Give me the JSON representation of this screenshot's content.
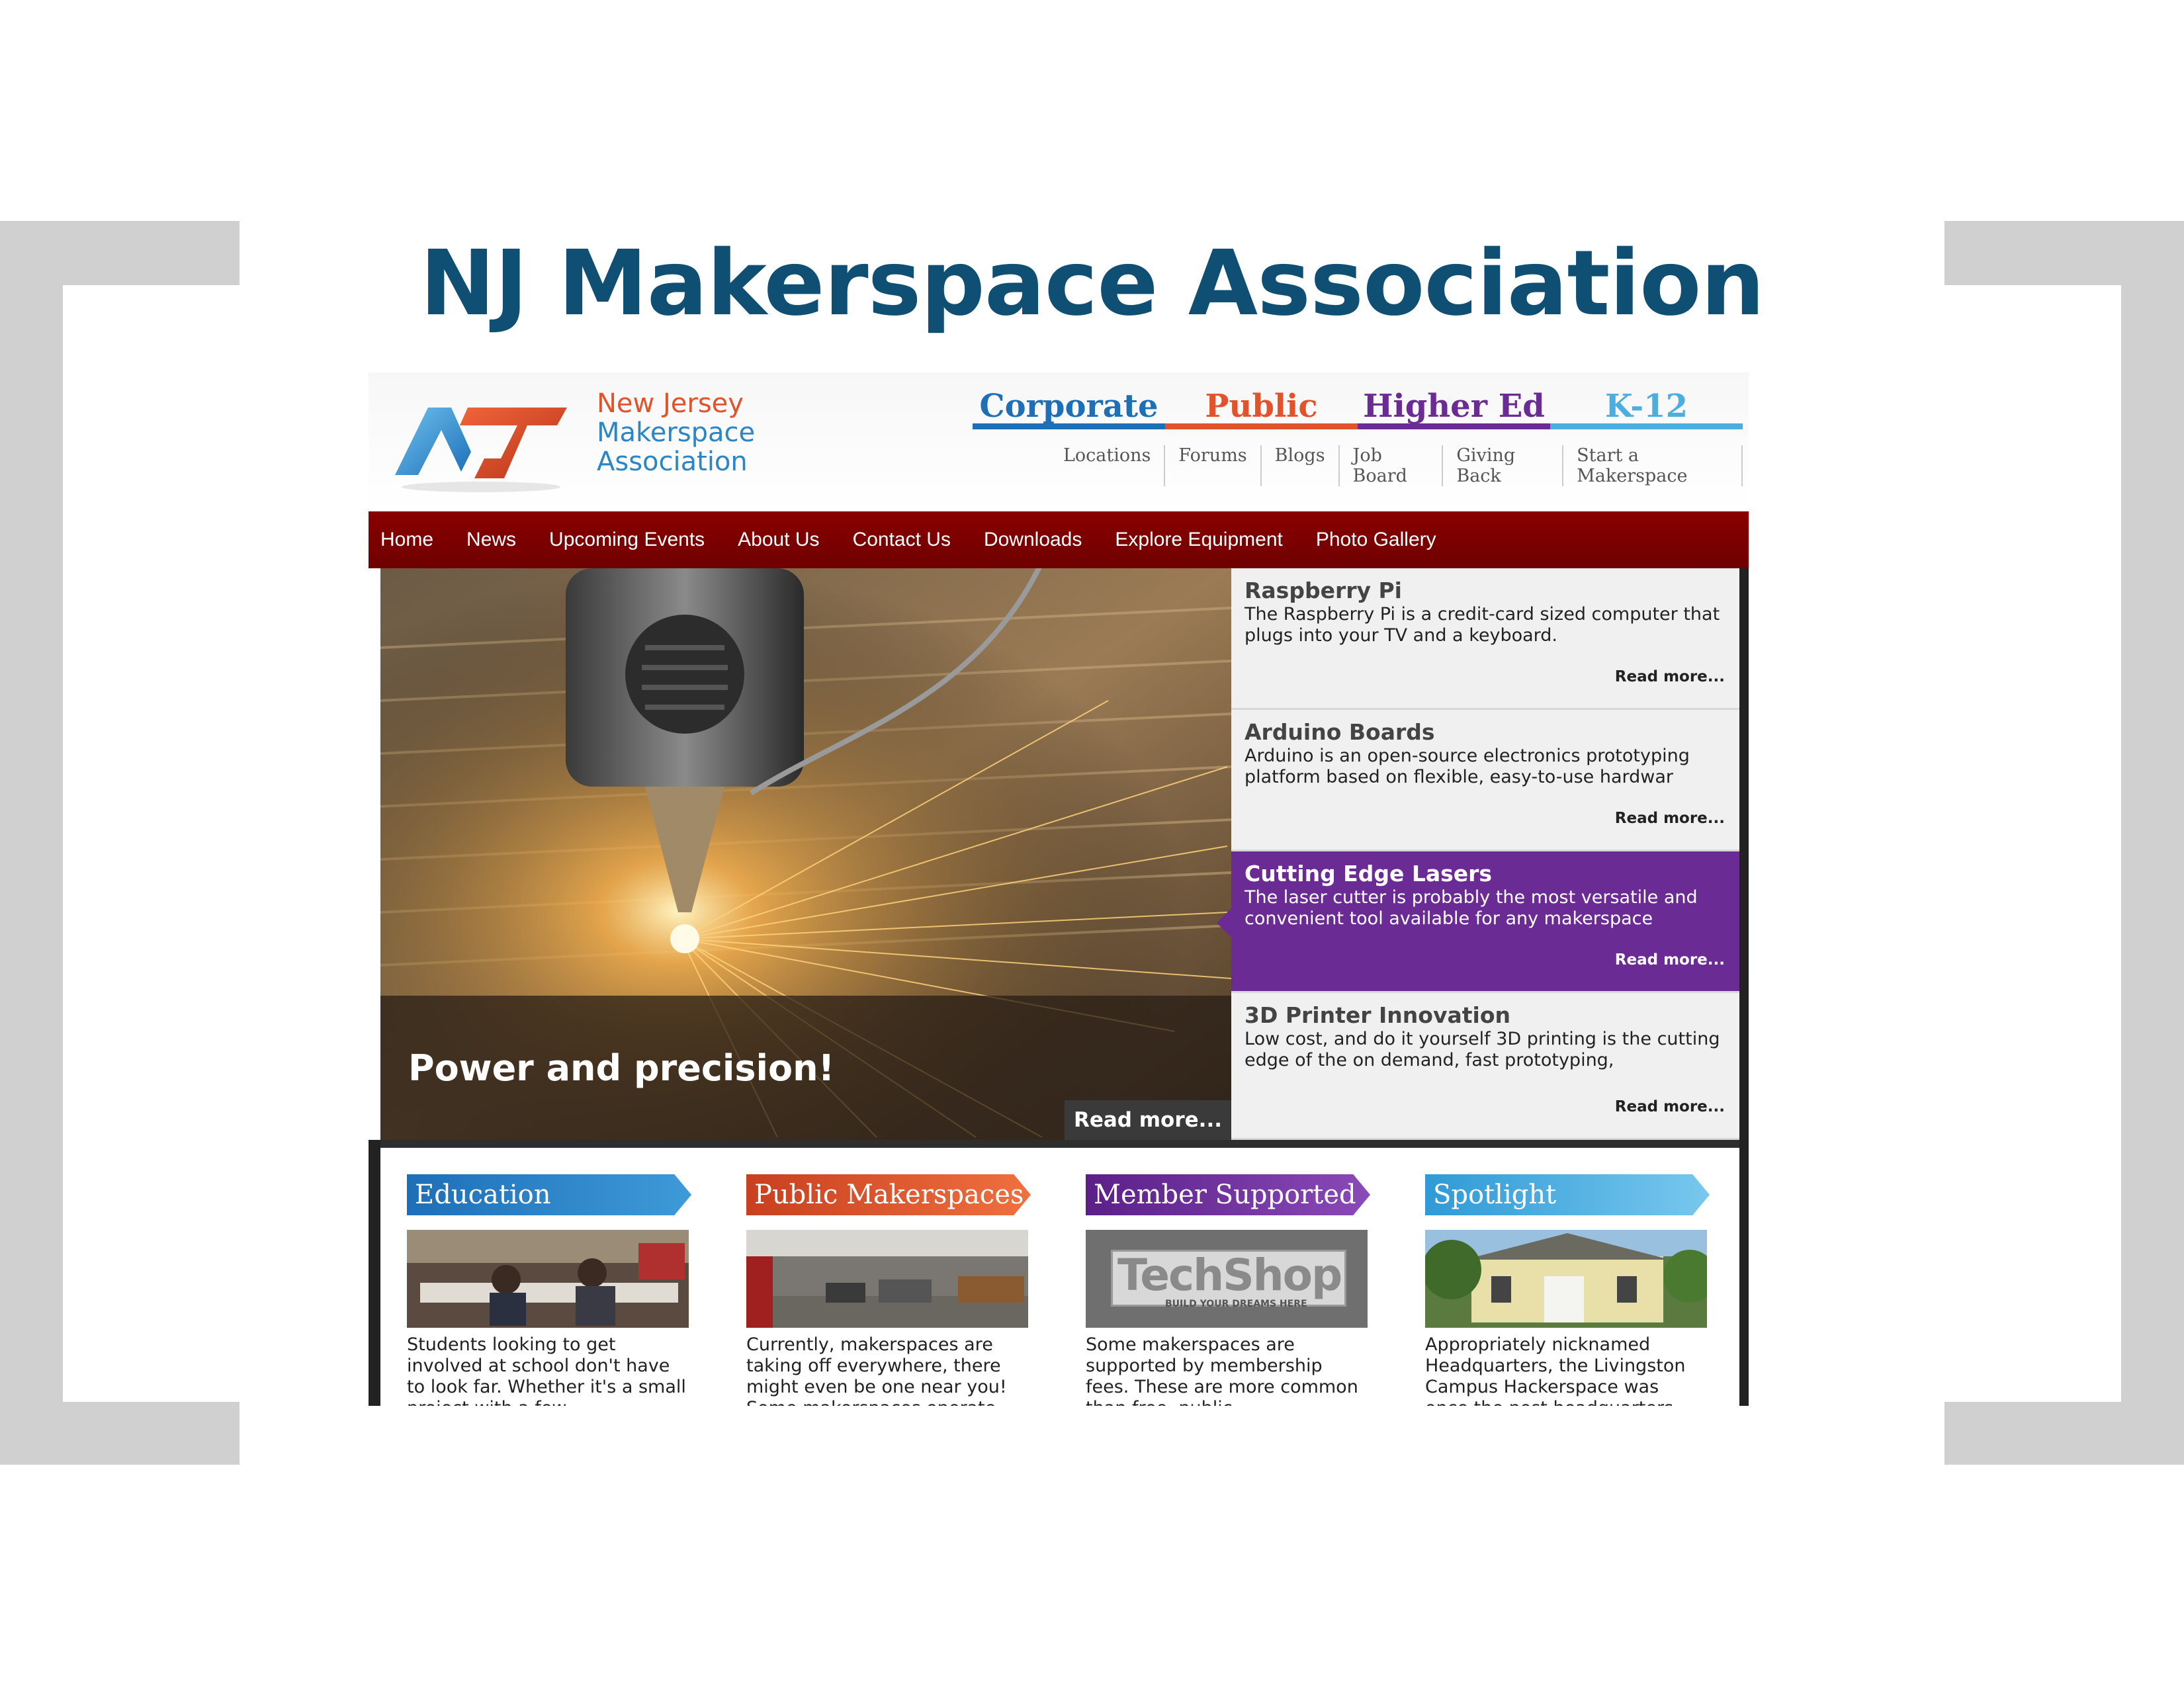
{
  "slide": {
    "title": "NJ Makerspace Association"
  },
  "site": {
    "logo_lines": [
      "New Jersey",
      "Makerspace",
      "Association"
    ],
    "categories": [
      {
        "label": "Corporate",
        "color": "#1d6fb8"
      },
      {
        "label": "Public",
        "color": "#e2532b"
      },
      {
        "label": "Higher Ed",
        "color": "#6a2b94"
      },
      {
        "label": "K-12",
        "color": "#4aaee0"
      }
    ],
    "sub_links": [
      "Locations",
      "Forums",
      "Blogs",
      "Job Board",
      "Giving Back",
      "Start a Makerspace"
    ],
    "nav": [
      "Home",
      "News",
      "Upcoming Events",
      "About Us",
      "Contact Us",
      "Downloads",
      "Explore Equipment",
      "Photo Gallery"
    ],
    "hero": {
      "caption": "Power and precision!",
      "read_more": "Read more..."
    },
    "side_items": [
      {
        "title": "Raspberry Pi",
        "desc": "The Raspberry Pi is a credit-card sized computer that plugs into your TV and a keyboard.",
        "read_more": "Read more..."
      },
      {
        "title": "Arduino Boards",
        "desc": "Arduino is an open-source electronics prototyping platform based on flexible, easy-to-use hardwar",
        "read_more": "Read more..."
      },
      {
        "title": "Cutting Edge Lasers",
        "desc": "The laser cutter is probably the most versatile and convenient tool available for any  makerspace",
        "read_more": "Read more..."
      },
      {
        "title": "3D Printer Innovation",
        "desc": "Low cost, and do it yourself 3D printing is the cutting edge of the on demand, fast prototyping,",
        "read_more": "Read more..."
      }
    ],
    "cards": [
      {
        "title": "Education",
        "color": "#1d6fb8",
        "text": "Students looking to get involved at school don't have to look far.  Whether it's a small project with a few"
      },
      {
        "title": "Public Makerspaces",
        "color": "#e2532b",
        "text": "Currently, makerspaces are taking off everywhere, there might even be one near you! Some makerspaces operate"
      },
      {
        "title": "Member Supported",
        "color": "#6a2b94",
        "text": "Some makerspaces are supported by membership fees.  These are more common than free, public"
      },
      {
        "title": "Spotlight",
        "color": "#4aaee0",
        "text": "Appropriately nicknamed Headquarters, the Livingston Campus Hackerspace was once the post headquarters"
      }
    ],
    "techshop_sign": "TechShop",
    "techshop_tagline": "BUILD YOUR DREAMS HERE"
  }
}
